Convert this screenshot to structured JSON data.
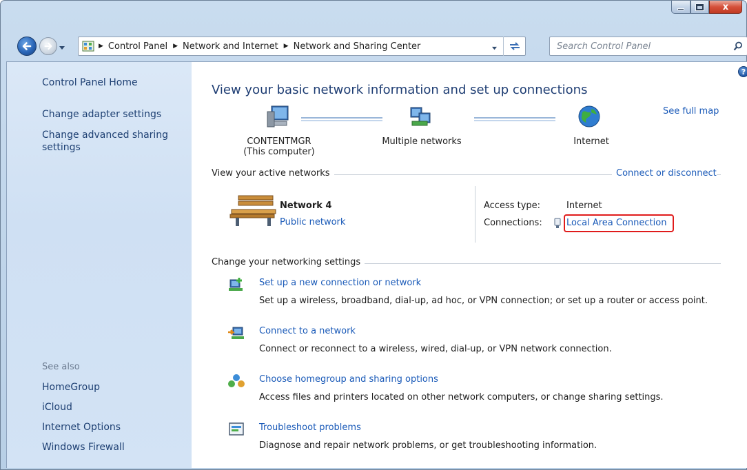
{
  "window": {
    "close_glyph": "x",
    "accent": "#1a5ab8"
  },
  "address": {
    "crumbs": [
      "Control Panel",
      "Network and Internet",
      "Network and Sharing Center"
    ],
    "search_placeholder": "Search Control Panel"
  },
  "sidebar": {
    "home": "Control Panel Home",
    "adapter": "Change adapter settings",
    "advanced_line1": "Change advanced sharing",
    "advanced_line2": "settings",
    "see_also": "See also",
    "also_items": [
      "HomeGroup",
      "iCloud",
      "Internet Options",
      "Windows Firewall"
    ]
  },
  "main": {
    "title": "View your basic network information and set up connections",
    "see_full_map": "See full map",
    "map": {
      "computer_name": "CONTENTMGR",
      "computer_sub": "(This computer)",
      "networks": "Multiple networks",
      "internet": "Internet"
    },
    "active": {
      "section": "View your active networks",
      "connect_link": "Connect or disconnect",
      "network_name": "Network 4",
      "network_type": "Public network",
      "access_label": "Access type:",
      "access_value": "Internet",
      "connections_label": "Connections:",
      "connections_value": "Local Area Connection"
    },
    "settings": {
      "section": "Change your networking settings",
      "tasks": [
        {
          "link": "Set up a new connection or network",
          "desc": "Set up a wireless, broadband, dial-up, ad hoc, or VPN connection; or set up a router or access point."
        },
        {
          "link": "Connect to a network",
          "desc": "Connect or reconnect to a wireless, wired, dial-up, or VPN network connection."
        },
        {
          "link": "Choose homegroup and sharing options",
          "desc": "Access files and printers located on other network computers, or change sharing settings."
        },
        {
          "link": "Troubleshoot problems",
          "desc": "Diagnose and repair network problems, or get troubleshooting information."
        }
      ]
    }
  }
}
